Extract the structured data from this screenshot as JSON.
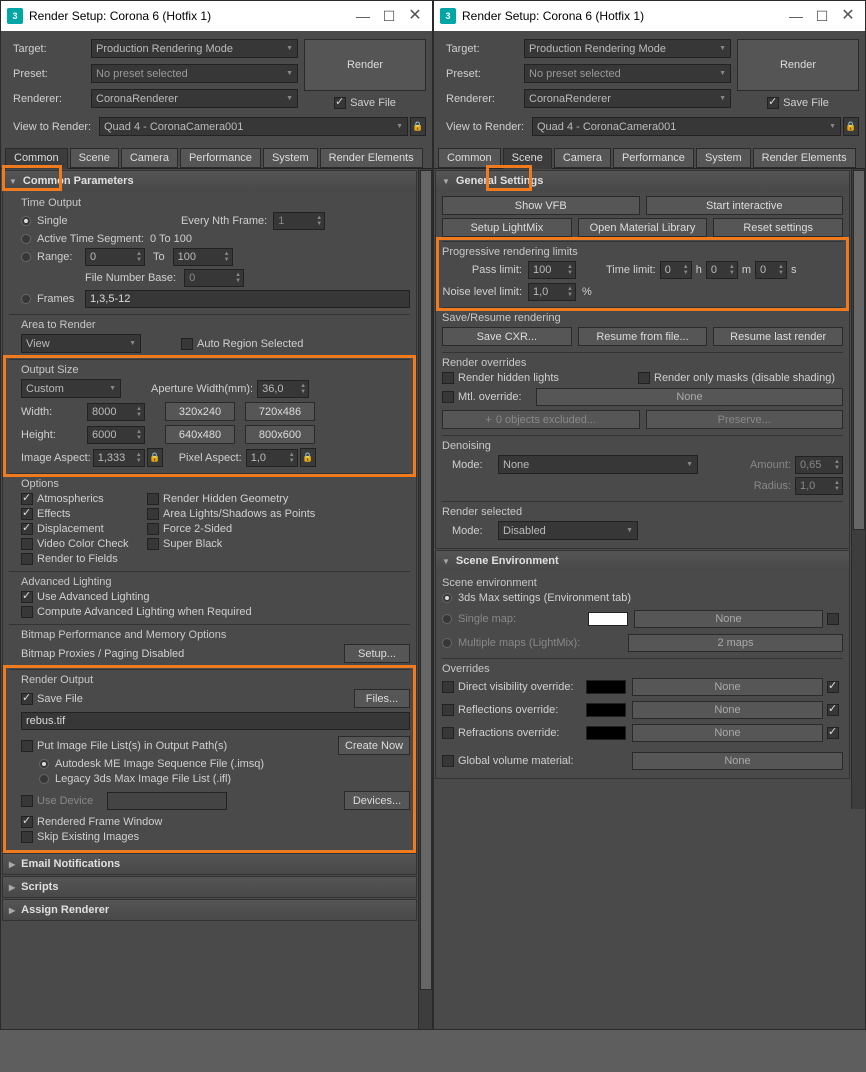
{
  "window": {
    "title": "Render Setup: Corona 6 (Hotfix 1)"
  },
  "top": {
    "target_lbl": "Target:",
    "target": "Production Rendering Mode",
    "preset_lbl": "Preset:",
    "preset": "No preset selected",
    "renderer_lbl": "Renderer:",
    "renderer": "CoronaRenderer",
    "savefile": "Save File",
    "render": "Render",
    "view_lbl": "View to Render:",
    "view": "Quad 4 - CoronaCamera001"
  },
  "tabs": {
    "common": "Common",
    "scene": "Scene",
    "camera": "Camera",
    "performance": "Performance",
    "system": "System",
    "elements": "Render Elements"
  },
  "common": {
    "head": "Common Parameters",
    "to": {
      "title": "Time Output",
      "single": "Single",
      "nth": "Every Nth Frame:",
      "nth_v": "1",
      "active": "Active Time Segment:",
      "active_r": "0 To 100",
      "range": "Range:",
      "r_from": "0",
      "r_to_lbl": "To",
      "r_to": "100",
      "fnb": "File Number Base:",
      "fnb_v": "0",
      "frames": "Frames",
      "frames_v": "1,3,5-12"
    },
    "atr": {
      "title": "Area to Render",
      "view": "View",
      "auto": "Auto Region Selected"
    },
    "os": {
      "title": "Output Size",
      "custom": "Custom",
      "ap_lbl": "Aperture Width(mm):",
      "ap": "36,0",
      "w_lbl": "Width:",
      "w": "8000",
      "h_lbl": "Height:",
      "h": "6000",
      "p1": "320x240",
      "p2": "720x486",
      "p3": "640x480",
      "p4": "800x600",
      "ia_lbl": "Image Aspect:",
      "ia": "1,333",
      "pa_lbl": "Pixel Aspect:",
      "pa": "1,0"
    },
    "opt": {
      "title": "Options",
      "atm": "Atmospherics",
      "rhg": "Render Hidden Geometry",
      "eff": "Effects",
      "alp": "Area Lights/Shadows as Points",
      "disp": "Displacement",
      "f2s": "Force 2-Sided",
      "vcc": "Video Color Check",
      "sb": "Super Black",
      "rtf": "Render to Fields"
    },
    "al": {
      "title": "Advanced Lighting",
      "use": "Use Advanced Lighting",
      "comp": "Compute Advanced Lighting when Required"
    },
    "bp": {
      "title": "Bitmap Performance and Memory Options",
      "prox": "Bitmap Proxies / Paging Disabled",
      "setup": "Setup..."
    },
    "ro": {
      "title": "Render Output",
      "sf": "Save File",
      "files": "Files...",
      "path": "rebus.tif",
      "put": "Put Image File List(s) in Output Path(s)",
      "create": "Create Now",
      "imsq": "Autodesk ME Image Sequence File (.imsq)",
      "ifl": "Legacy 3ds Max Image File List (.ifl)",
      "ud": "Use Device",
      "dev": "Devices...",
      "rfw": "Rendered Frame Window",
      "sei": "Skip Existing Images"
    },
    "en": "Email Notifications",
    "sc": "Scripts",
    "ar": "Assign Renderer"
  },
  "scene": {
    "gs": {
      "head": "General Settings",
      "vfb": "Show VFB",
      "si": "Start interactive",
      "slm": "Setup LightMix",
      "oml": "Open Material Library",
      "rs": "Reset settings",
      "prl": "Progressive rendering limits",
      "pl": "Pass limit:",
      "pl_v": "100",
      "tl": "Time limit:",
      "t0": "0",
      "h": "h",
      "m": "m",
      "s": "s",
      "nll": "Noise level limit:",
      "nll_v": "1,0",
      "pct": "%",
      "srr": "Save/Resume rendering",
      "scxr": "Save CXR...",
      "rff": "Resume from file...",
      "rlr": "Resume last render",
      "rov": "Render overrides",
      "rhl": "Render hidden lights",
      "rom": "Render only masks (disable shading)",
      "mov": "Mtl. override:",
      "none": "None",
      "obj": "0 objects excluded...",
      "pres": "Preserve...",
      "den": "Denoising",
      "mode": "Mode:",
      "amt": "Amount:",
      "amt_v": "0,65",
      "rad": "Radius:",
      "rad_v": "1,0",
      "rsel": "Render selected",
      "dis": "Disabled"
    },
    "se": {
      "head": "Scene Environment",
      "senv": "Scene environment",
      "max": "3ds Max settings (Environment tab)",
      "sm": "Single map:",
      "mm": "Multiple maps (LightMix):",
      "maps2": "2 maps",
      "ov": "Overrides",
      "dvo": "Direct visibility override:",
      "rfo": "Reflections override:",
      "rfro": "Refractions override:",
      "gvm": "Global volume material:",
      "none": "None"
    }
  }
}
